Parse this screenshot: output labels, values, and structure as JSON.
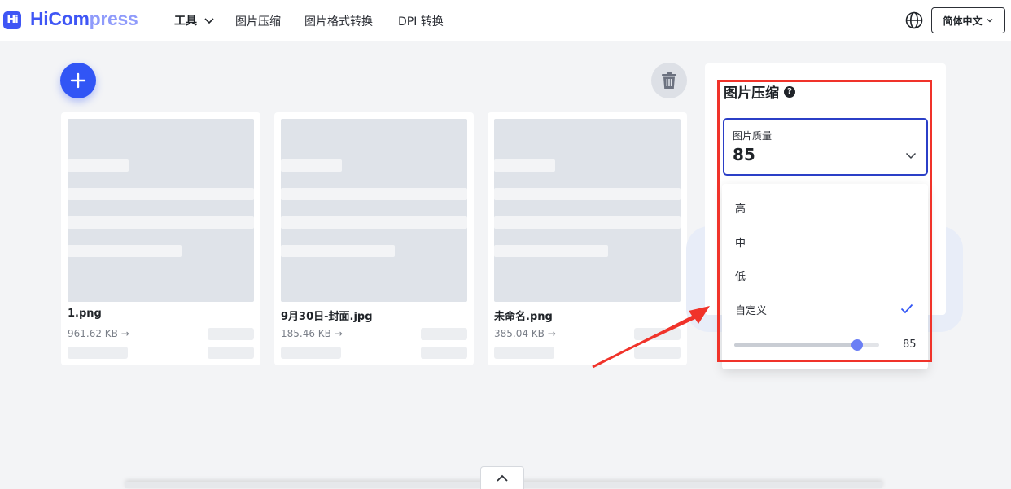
{
  "brand": {
    "mark": "Hi",
    "name_part1": "Hi",
    "name_part2": "Com",
    "name_part3": "press"
  },
  "nav": {
    "tools_label": "工具",
    "links": [
      "图片压缩",
      "图片格式转换",
      "DPI 转换"
    ]
  },
  "language": {
    "label": "简体中文"
  },
  "files": [
    {
      "name": "1.png",
      "size": "961.62 KB →"
    },
    {
      "name": "9月30日-封面.jpg",
      "size": "185.46 KB →"
    },
    {
      "name": "未命名.png",
      "size": "385.04 KB →"
    }
  ],
  "panel": {
    "title": "图片压缩",
    "help_symbol": "?",
    "quality": {
      "label": "图片质量",
      "value": "85"
    },
    "options": [
      "高",
      "中",
      "低",
      "自定义"
    ],
    "selected_option": "自定义",
    "slider": {
      "value": 85,
      "min": 0,
      "max": 100,
      "display": "85"
    }
  },
  "colors": {
    "brand": "#3f56f5",
    "annotation": "#f0332a",
    "accent": "#3155f5"
  }
}
